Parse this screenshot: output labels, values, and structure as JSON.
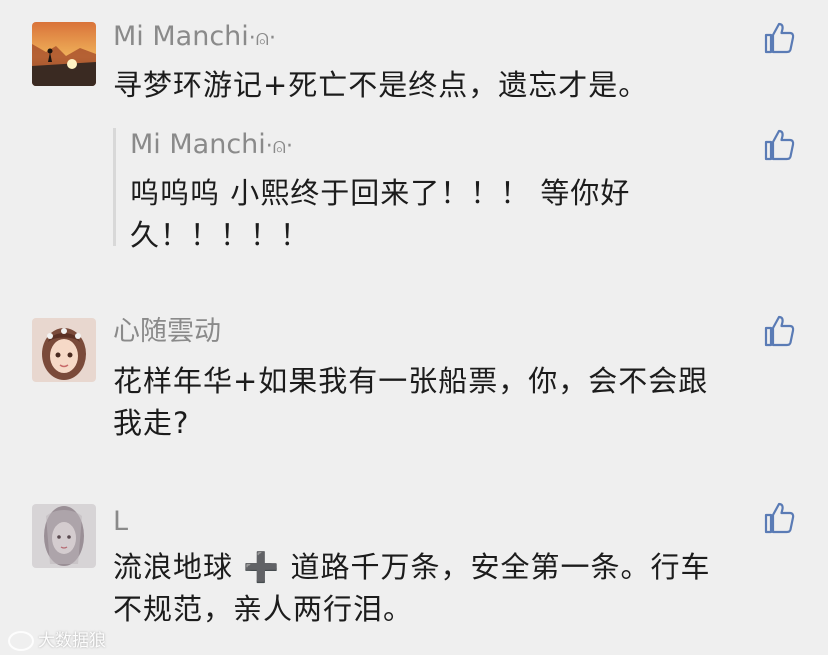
{
  "comments": [
    {
      "username": "Mi Manchi",
      "badge": "·⍝·",
      "text": "寻梦环游记+死亡不是终点，遗忘才是。",
      "reply": {
        "username": "Mi Manchi",
        "badge": "·⍝·",
        "line1": "呜呜呜 小熙终于回来了！！！ 等你好",
        "line2": "久！！！！！"
      }
    },
    {
      "username": "心随雲动",
      "line1": "花样年华+如果我有一张船票，你，会不会跟",
      "line2": "我走?"
    },
    {
      "username": "L",
      "line1": "流浪地球 ➕ 道路千万条，安全第一条。行车",
      "line2": "不规范，亲人两行泪。"
    }
  ],
  "icons": {
    "like": "thumbs-up-icon"
  },
  "watermark": "大数据狼",
  "colors": {
    "background": "#efefef",
    "username": "#8a8a8a",
    "text": "#1c1c1c",
    "like": "#5a7bb5"
  }
}
